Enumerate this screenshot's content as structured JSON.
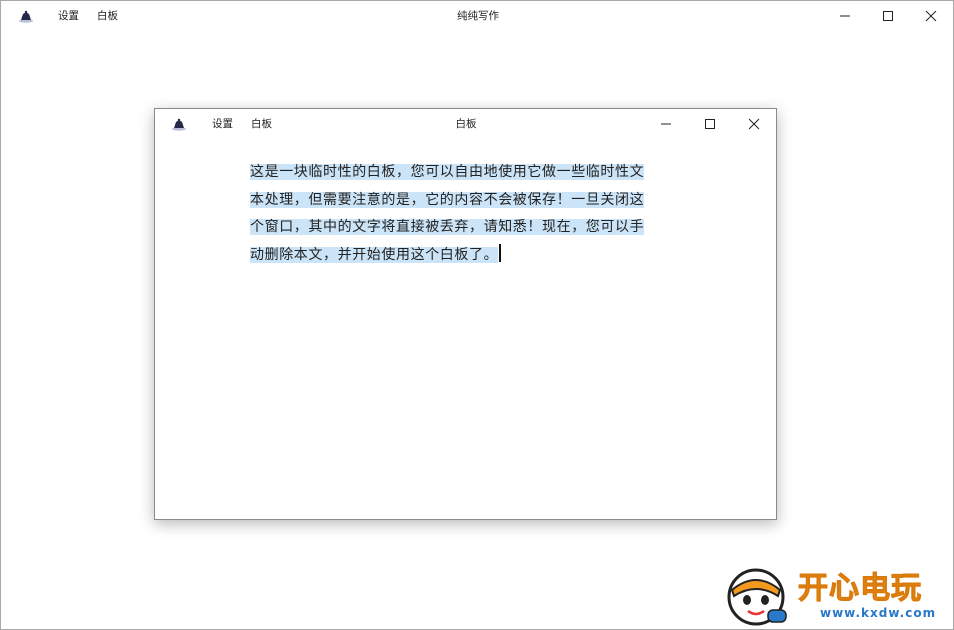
{
  "main_window": {
    "title": "纯纯写作",
    "menu": {
      "settings": "设置",
      "whiteboard": "白板"
    }
  },
  "dialog": {
    "title": "白板",
    "menu": {
      "settings": "设置",
      "whiteboard": "白板"
    },
    "editor_lines": [
      "这是一块临时性的白板，您可以自由地使用它做一些临时性文",
      "本处理，但需要注意的是，它的内容不会被保存！一旦关闭这",
      "个窗口，其中的文字将直接被丢弃，请知悉！现在，您可以手",
      "动删除本文，并开始使用这个白板了。"
    ]
  },
  "watermark": {
    "brand": "开心电玩",
    "url": "www.kxdw.com"
  },
  "colors": {
    "selection": "#cce4f7",
    "watermark_orange": "#f39a1e",
    "watermark_blue": "#2a78c8"
  },
  "icons": {
    "app": "app-hat-icon",
    "minimize": "minimize-icon",
    "maximize": "maximize-icon",
    "close": "close-icon",
    "mascot": "mascot-logo-icon"
  }
}
